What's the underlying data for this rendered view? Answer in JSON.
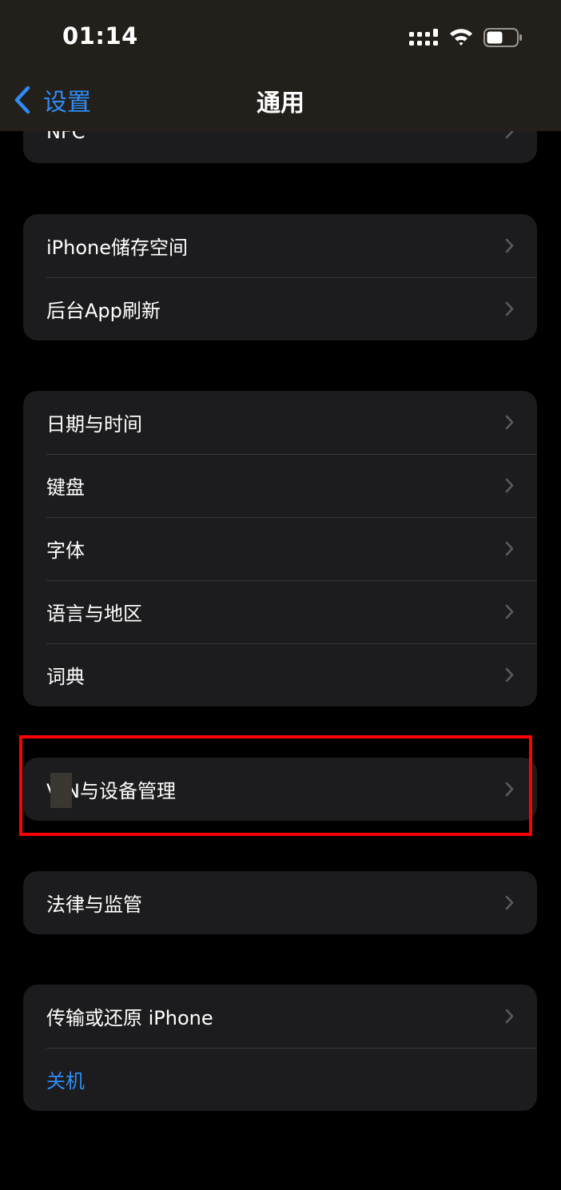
{
  "status_bar": {
    "time": "01:14",
    "icons": [
      "cellular-signal-icon",
      "wifi-icon",
      "battery-icon"
    ]
  },
  "nav": {
    "back_label": "设置",
    "title": "通用"
  },
  "groups": [
    {
      "rows": [
        {
          "label": "NFC",
          "chevron": true
        }
      ]
    },
    {
      "rows": [
        {
          "label": "iPhone储存空间",
          "chevron": true
        },
        {
          "label": "后台App刷新",
          "chevron": true
        }
      ]
    },
    {
      "rows": [
        {
          "label": "日期与时间",
          "chevron": true
        },
        {
          "label": "键盘",
          "chevron": true
        },
        {
          "label": "字体",
          "chevron": true
        },
        {
          "label": "语言与地区",
          "chevron": true
        },
        {
          "label": "词典",
          "chevron": true
        }
      ]
    },
    {
      "rows": [
        {
          "label": "V N与设备管理",
          "chevron": true,
          "highlighted": true
        }
      ]
    },
    {
      "rows": [
        {
          "label": "法律与监管",
          "chevron": true
        }
      ]
    },
    {
      "rows": [
        {
          "label": "传输或还原 iPhone",
          "chevron": true
        },
        {
          "label": "关机",
          "chevron": false,
          "link": true
        }
      ]
    }
  ],
  "colors": {
    "background": "#000000",
    "cell": "#1c1c1e",
    "separator": "#38383a",
    "accent": "#2f8cf6",
    "chevron": "#5a5a5e",
    "highlight": "#ff0000"
  }
}
